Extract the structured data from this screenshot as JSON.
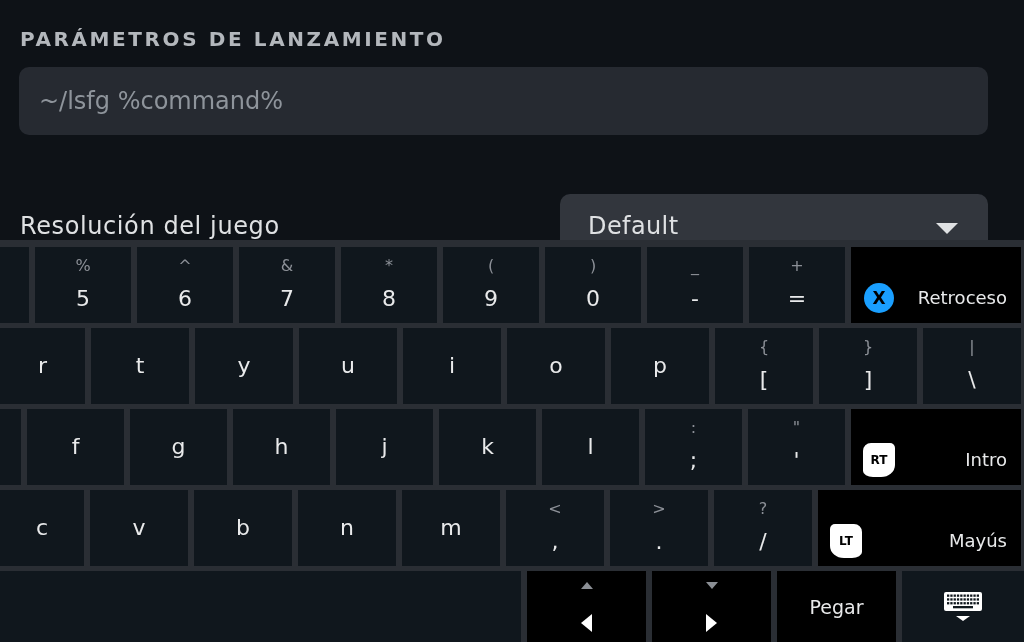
{
  "launch_options": {
    "label": "PARÁMETROS DE LANZAMIENTO",
    "value": "~/lsfg %command%"
  },
  "game_resolution": {
    "label": "Resolución del juego",
    "value": "Default"
  },
  "keyboard": {
    "rows": [
      [
        {
          "kind": "blank"
        },
        {
          "kind": "char",
          "shift": "%",
          "main": "5"
        },
        {
          "kind": "char",
          "shift": "^",
          "main": "6"
        },
        {
          "kind": "char",
          "shift": "&",
          "main": "7"
        },
        {
          "kind": "char",
          "shift": "*",
          "main": "8"
        },
        {
          "kind": "char",
          "shift": "(",
          "main": "9"
        },
        {
          "kind": "char",
          "shift": ")",
          "main": "0"
        },
        {
          "kind": "char",
          "shift": "_",
          "main": "-"
        },
        {
          "kind": "char",
          "shift": "+",
          "main": "="
        },
        {
          "kind": "backspace",
          "hint": "X",
          "label": "Retroceso"
        }
      ],
      [
        {
          "kind": "char",
          "main": "r"
        },
        {
          "kind": "char",
          "main": "t"
        },
        {
          "kind": "char",
          "main": "y"
        },
        {
          "kind": "char",
          "main": "u"
        },
        {
          "kind": "char",
          "main": "i"
        },
        {
          "kind": "char",
          "main": "o"
        },
        {
          "kind": "char",
          "main": "p"
        },
        {
          "kind": "char",
          "shift": "{",
          "main": "["
        },
        {
          "kind": "char",
          "shift": "}",
          "main": "]"
        },
        {
          "kind": "char",
          "shift": "|",
          "main": "\\"
        }
      ],
      [
        {
          "kind": "blank"
        },
        {
          "kind": "char",
          "main": "f"
        },
        {
          "kind": "char",
          "main": "g"
        },
        {
          "kind": "char",
          "main": "h"
        },
        {
          "kind": "char",
          "main": "j"
        },
        {
          "kind": "char",
          "main": "k"
        },
        {
          "kind": "char",
          "main": "l"
        },
        {
          "kind": "char",
          "shift": ":",
          "main": ";"
        },
        {
          "kind": "char",
          "shift": "\"",
          "main": "'"
        },
        {
          "kind": "enter",
          "hint": "RT",
          "label": "Intro"
        }
      ],
      [
        {
          "kind": "char",
          "main": "c"
        },
        {
          "kind": "char",
          "main": "v"
        },
        {
          "kind": "char",
          "main": "b"
        },
        {
          "kind": "char",
          "main": "n"
        },
        {
          "kind": "char",
          "main": "m"
        },
        {
          "kind": "char",
          "shift": "<",
          "main": ","
        },
        {
          "kind": "char",
          "shift": ">",
          "main": "."
        },
        {
          "kind": "char",
          "shift": "?",
          "main": "/"
        },
        {
          "kind": "shift",
          "hint": "LT",
          "label": "Mayús"
        }
      ],
      [
        {
          "kind": "blank"
        },
        {
          "kind": "arrow_left"
        },
        {
          "kind": "arrow_right"
        },
        {
          "kind": "paste",
          "label": "Pegar"
        },
        {
          "kind": "keyboard"
        }
      ]
    ]
  }
}
